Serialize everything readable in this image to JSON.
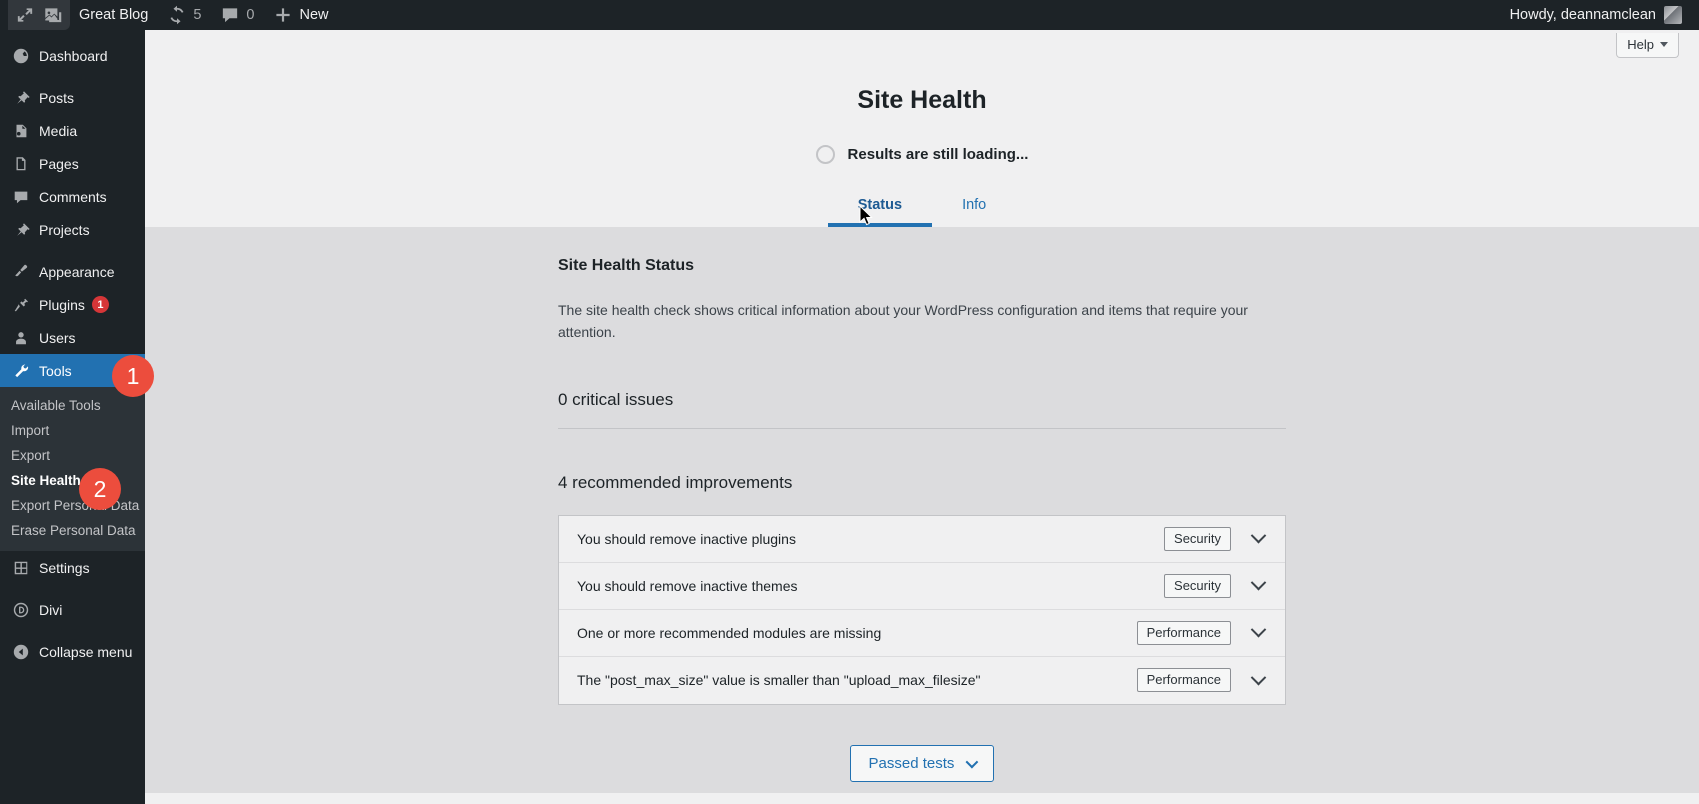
{
  "adminbar": {
    "logo_icon": "wordpress-collapse-icon",
    "customize_icon": "customize-image-icon",
    "site_name": "Great Blog",
    "updates": {
      "icon": "updates-icon",
      "count": "5"
    },
    "comments": {
      "icon": "comment-bubble-icon",
      "count": "0"
    },
    "new": {
      "icon": "plus-icon",
      "label": "New"
    },
    "account": {
      "greeting": "Howdy, deannamclean",
      "avatar": "user-avatar"
    }
  },
  "sidebar": {
    "items": [
      {
        "label": "Dashboard",
        "icon": "dashboard-icon"
      },
      {
        "label": "Posts",
        "icon": "pin-icon"
      },
      {
        "label": "Media",
        "icon": "media-icon"
      },
      {
        "label": "Pages",
        "icon": "pages-icon"
      },
      {
        "label": "Comments",
        "icon": "comments-icon"
      },
      {
        "label": "Projects",
        "icon": "pin-icon"
      },
      {
        "label": "Appearance",
        "icon": "paintbrush-icon"
      },
      {
        "label": "Plugins",
        "icon": "plugins-icon",
        "badge": "1"
      },
      {
        "label": "Users",
        "icon": "users-icon"
      },
      {
        "label": "Tools",
        "icon": "tools-icon",
        "current": true
      },
      {
        "label": "Settings",
        "icon": "settings-icon"
      },
      {
        "label": "Divi",
        "icon": "divi-icon"
      },
      {
        "label": "Collapse menu",
        "icon": "collapse-arrow-icon"
      }
    ],
    "submenu": [
      {
        "label": "Available Tools"
      },
      {
        "label": "Import"
      },
      {
        "label": "Export"
      },
      {
        "label": "Site Health",
        "current": true
      },
      {
        "label": "Export Personal Data"
      },
      {
        "label": "Erase Personal Data"
      }
    ],
    "step_badges": [
      {
        "number": "1",
        "target": "Tools"
      },
      {
        "number": "2",
        "target": "Site Health"
      }
    ]
  },
  "help_tab": {
    "label": "Help",
    "icon": "chevron-down-icon"
  },
  "page": {
    "title": "Site Health",
    "progress_text": "Results are still loading...",
    "progress_icon": "loading-spinner-icon",
    "tabs": [
      {
        "label": "Status",
        "active": true
      },
      {
        "label": "Info",
        "active": false
      }
    ],
    "status_heading": "Site Health Status",
    "status_description": "The site health check shows critical information about your WordPress configuration and items that require your attention.",
    "critical_heading": "0 critical issues",
    "recommended_heading": "4 recommended improvements",
    "issues": [
      {
        "label": "You should remove inactive plugins",
        "badge": "Security",
        "chevron": "chevron-down-icon"
      },
      {
        "label": "You should remove inactive themes",
        "badge": "Security",
        "chevron": "chevron-down-icon"
      },
      {
        "label": "One or more recommended modules are missing",
        "badge": "Performance",
        "chevron": "chevron-down-icon"
      },
      {
        "label": "The \"post_max_size\" value is smaller than \"upload_max_filesize\"",
        "badge": "Performance",
        "chevron": "chevron-down-icon"
      }
    ],
    "passed_tests": {
      "label": "Passed tests",
      "icon": "chevron-down-icon"
    }
  },
  "colors": {
    "sidebar_bg": "#1d2327",
    "submenu_bg": "#2c3338",
    "current_menu": "#2271b1",
    "badge_red": "#d63638",
    "step_bubble": "#ec4d3d",
    "link_blue": "#2271b1",
    "body_bg": "#dcdcde",
    "panel_bg": "#f0f0f1"
  }
}
